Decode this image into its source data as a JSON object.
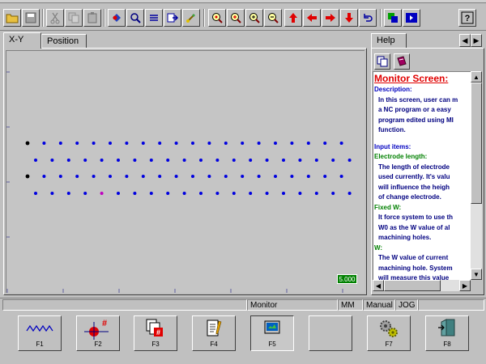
{
  "tabs": {
    "xy": "X-Y",
    "position": "Position"
  },
  "toolbar": {
    "icons": [
      "open-folder-icon",
      "save-icon",
      "cut-icon",
      "copy-icon",
      "paste-icon",
      "marker-icon",
      "search-icon",
      "list-icon",
      "export-icon",
      "brush-icon",
      "zoom-in-icon",
      "zoom-plus-icon",
      "zoom-in-small-icon",
      "zoom-out-icon",
      "arrow-up-icon",
      "arrow-left-icon",
      "arrow-right-icon",
      "arrow-down-icon",
      "undo-icon",
      "color-block-icon",
      "next-page-icon",
      "help-icon"
    ]
  },
  "plot": {
    "scale_label": "5.000",
    "rows": [
      {
        "count": 20,
        "first_black": true
      },
      {
        "count": 20,
        "first_black": false
      },
      {
        "count": 20,
        "first_black": true
      },
      {
        "count": 20,
        "first_black": false,
        "marker_index": 4
      }
    ],
    "colors": {
      "point": "#0000e0",
      "first": "#000000",
      "marker": "#c000c0",
      "background": "#c5c5c5"
    }
  },
  "help": {
    "tab_label": "Help",
    "title": "Monitor Screen:",
    "lines": [
      {
        "cls": "hd",
        "text": "Description:"
      },
      {
        "cls": "bd",
        "text": "In this screen, user can m"
      },
      {
        "cls": "bd",
        "text": "a NC program or a easy"
      },
      {
        "cls": "bd",
        "text": "program edited using MI"
      },
      {
        "cls": "bd",
        "text": "function."
      },
      {
        "cls": "gap",
        "text": ""
      },
      {
        "cls": "hd",
        "text": "Input items:"
      },
      {
        "cls": "gr",
        "text": "Electrode length:"
      },
      {
        "cls": "bd",
        "text": "The length of electrode"
      },
      {
        "cls": "bd",
        "text": "used currently.  It's valu"
      },
      {
        "cls": "bd",
        "text": "will influence the heigh"
      },
      {
        "cls": "bd",
        "text": "of change electrode."
      },
      {
        "cls": "gr",
        "text": "Fixed W:"
      },
      {
        "cls": "bd",
        "text": "It force system to use th"
      },
      {
        "cls": "bd",
        "text": "W0 as the W value of al"
      },
      {
        "cls": "bd",
        "text": "machining holes."
      },
      {
        "cls": "gr",
        "text": "W:"
      },
      {
        "cls": "bd",
        "text": "The W value of current"
      },
      {
        "cls": "bd",
        "text": "machining hole. System"
      },
      {
        "cls": "bd",
        "text": "will measure this value"
      }
    ]
  },
  "status": {
    "mode_label": "Monitor",
    "unit": "MM",
    "manual": "Manual",
    "jog": "JOG"
  },
  "fkeys": [
    {
      "label": "F1",
      "icon": "wave-icon"
    },
    {
      "label": "F2",
      "icon": "crosshair-hash-icon"
    },
    {
      "label": "F3",
      "icon": "documents-hash-icon"
    },
    {
      "label": "F4",
      "icon": "notepad-pen-icon"
    },
    {
      "label": "F5",
      "icon": "monitor-screen-icon",
      "pressed": true
    },
    {
      "label": "",
      "icon": ""
    },
    {
      "label": "F7",
      "icon": "gears-icon"
    },
    {
      "label": "F8",
      "icon": "exit-door-icon"
    }
  ]
}
